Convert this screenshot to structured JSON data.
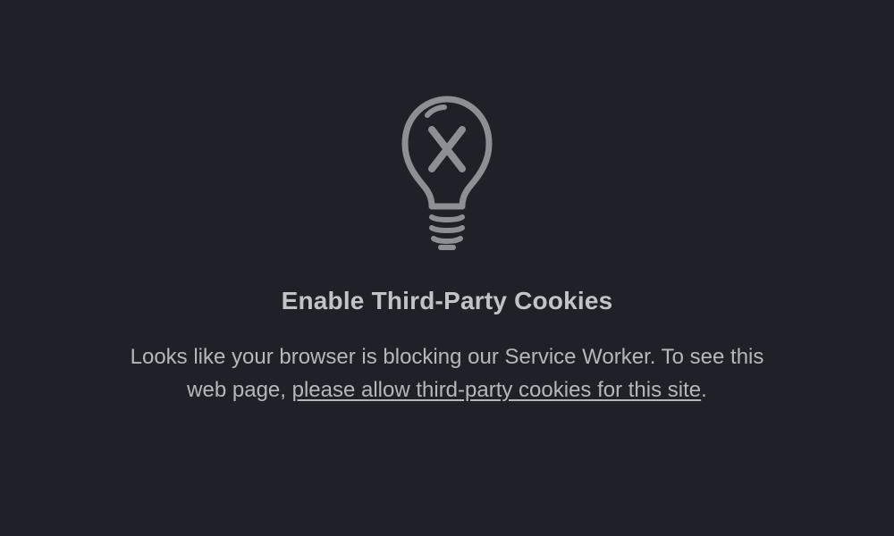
{
  "heading": "Enable Third-Party Cookies",
  "message_prefix": "Looks like your browser is blocking our Service Worker. To see this web page, ",
  "message_link": "please allow third-party cookies for this site",
  "message_suffix": "."
}
